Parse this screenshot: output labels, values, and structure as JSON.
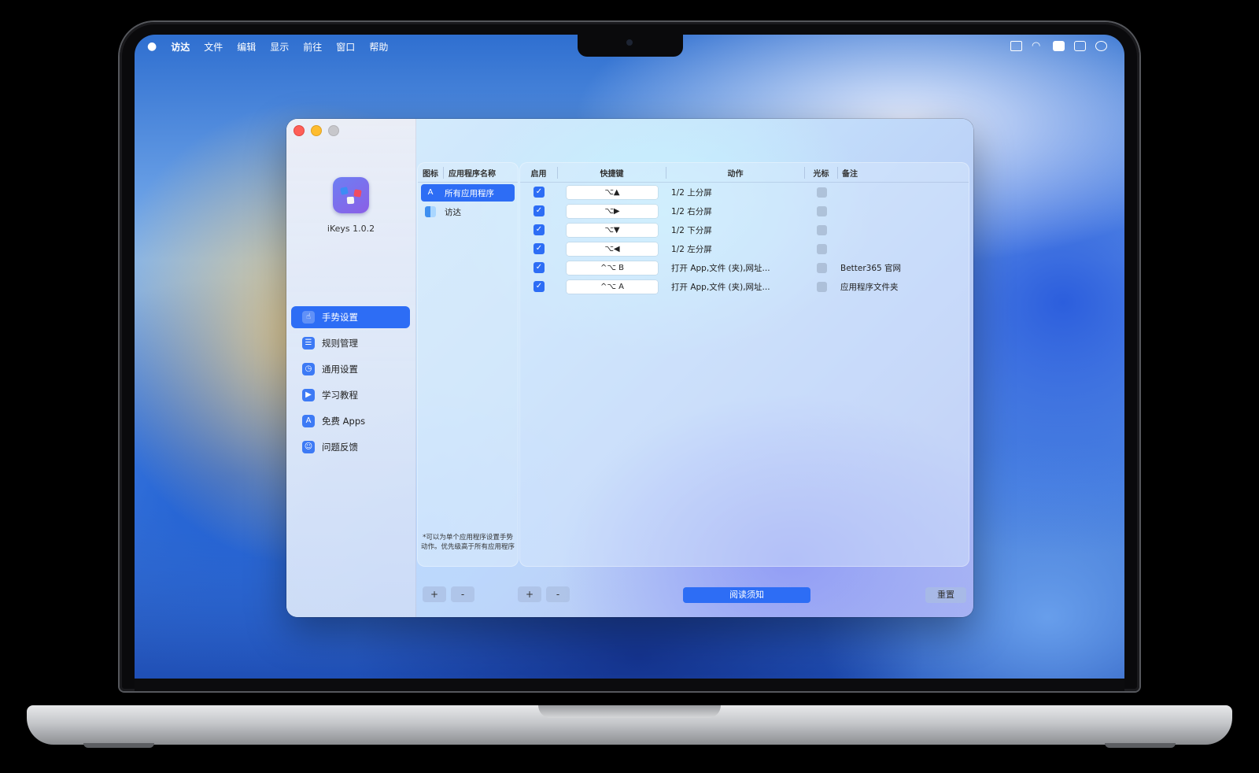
{
  "menubar": {
    "apple": "",
    "items": [
      "访达",
      "文件",
      "编辑",
      "显示",
      "前往",
      "窗口",
      "帮助"
    ]
  },
  "app": {
    "version": "iKeys 1.0.2",
    "icon": "ikeys-app-icon"
  },
  "sidebar": {
    "items": [
      {
        "label": "手势设置",
        "icon": "gesture-icon",
        "glyph": "☝",
        "active": true
      },
      {
        "label": "规则管理",
        "icon": "list-icon",
        "glyph": "☰",
        "active": false
      },
      {
        "label": "通用设置",
        "icon": "clock-icon",
        "glyph": "◷",
        "active": false
      },
      {
        "label": "学习教程",
        "icon": "play-icon",
        "glyph": "▶",
        "active": false
      },
      {
        "label": "免费 Apps",
        "icon": "appstore-icon",
        "glyph": "A",
        "active": false
      },
      {
        "label": "问题反馈",
        "icon": "people-icon",
        "glyph": "☺",
        "active": false
      }
    ]
  },
  "apps_panel": {
    "columns": [
      "图标",
      "应用程序名称"
    ],
    "rows": [
      {
        "name": "所有应用程序",
        "icon": "appstore-icon",
        "glyph": "A",
        "selected": true
      },
      {
        "name": "访达",
        "icon": "finder-icon",
        "glyph": "",
        "selected": false
      }
    ],
    "note": "*可以为单个应用程序设置手势动作。优先级高于所有应用程序"
  },
  "shortcuts": {
    "columns": [
      "启用",
      "快捷键",
      "动作",
      "光标",
      "备注"
    ],
    "rows": [
      {
        "enabled": true,
        "shortcut": "⌥▲",
        "action": "1/2 上分屏",
        "cursor": false,
        "note": ""
      },
      {
        "enabled": true,
        "shortcut": "⌥▶",
        "action": "1/2 右分屏",
        "cursor": false,
        "note": ""
      },
      {
        "enabled": true,
        "shortcut": "⌥▼",
        "action": "1/2 下分屏",
        "cursor": false,
        "note": ""
      },
      {
        "enabled": true,
        "shortcut": "⌥◀",
        "action": "1/2 左分屏",
        "cursor": false,
        "note": ""
      },
      {
        "enabled": true,
        "shortcut": "^⌥ B",
        "action": "打开 App,文件 (夹),网址...",
        "cursor": false,
        "note": "Better365 官网"
      },
      {
        "enabled": true,
        "shortcut": "^⌥ A",
        "action": "打开 App,文件 (夹),网址...",
        "cursor": false,
        "note": "应用程序文件夹"
      }
    ]
  },
  "buttons": {
    "add": "+",
    "remove": "-",
    "read_notice": "阅读须知",
    "reset": "重置"
  }
}
